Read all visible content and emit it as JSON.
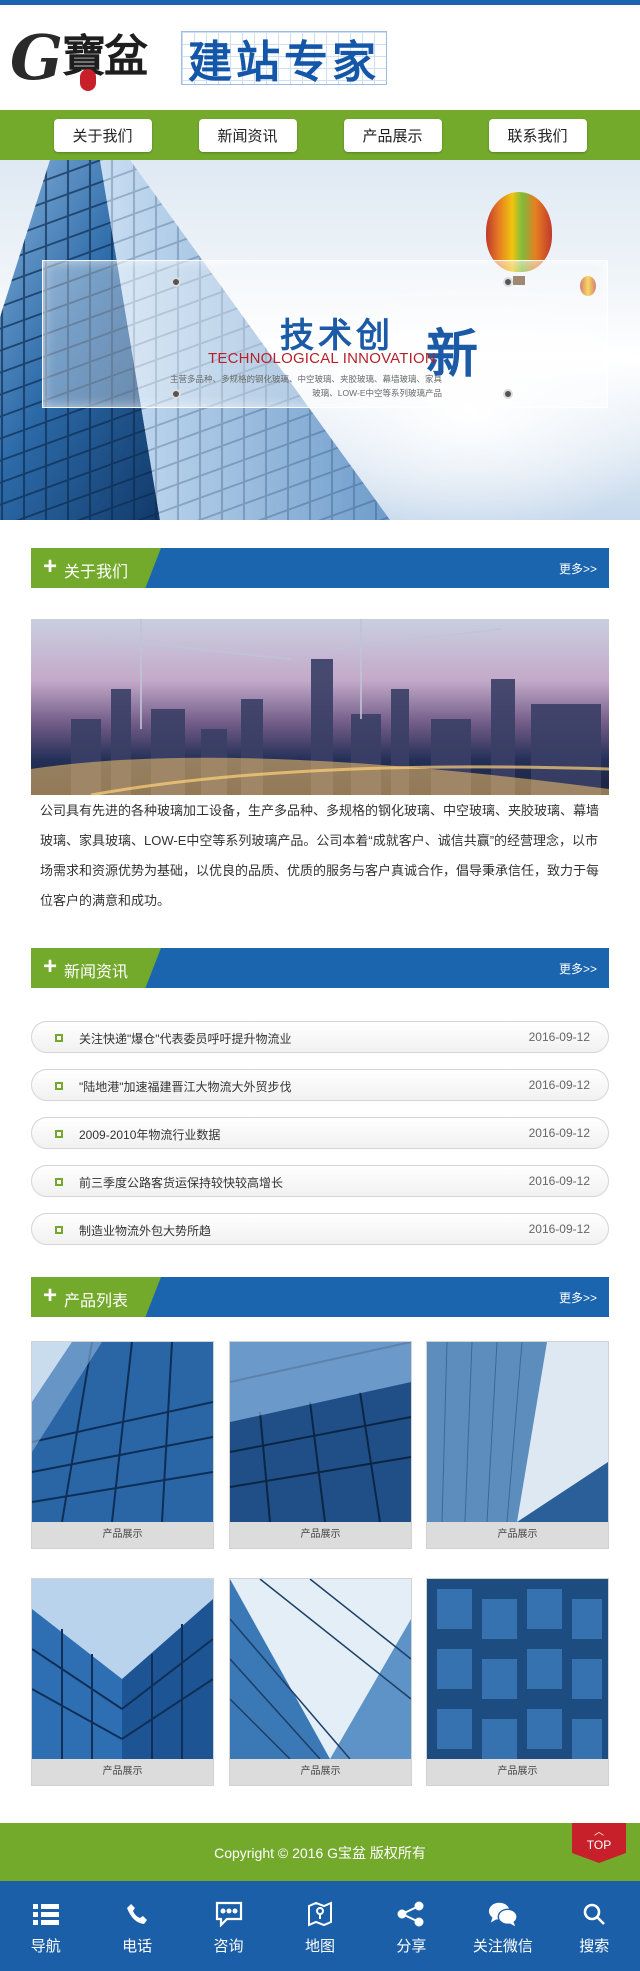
{
  "brand": {
    "logo_letter": "G",
    "logo_chinese": "寶盆",
    "title": "建站专家"
  },
  "nav": [
    {
      "label": "关于我们"
    },
    {
      "label": "新闻资讯"
    },
    {
      "label": "产品展示"
    },
    {
      "label": "联系我们"
    }
  ],
  "banner": {
    "slogan_cn_main": "技术创",
    "slogan_cn_big": "新",
    "slogan_en": "TECHNOLOGICAL INNOVATION",
    "slogan_sub": "主营多品种、多规格的钢化玻璃、中空玻璃、夹胶玻璃、幕墙玻璃、家具玻璃、LOW-E中空等系列玻璃产品"
  },
  "about": {
    "section_title": "关于我们",
    "more": "更多>>",
    "text": "公司具有先进的各种玻璃加工设备，生产多品种、多规格的钢化玻璃、中空玻璃、夹胶玻璃、幕墙玻璃、家具玻璃、LOW-E中空等系列玻璃产品。公司本着“成就客户、诚信共赢”的经营理念，以市场需求和资源优势为基础，以优良的品质、优质的服务与客户真诚合作，倡导秉承信任，致力于每位客户的满意和成功。"
  },
  "news": {
    "section_title": "新闻资讯",
    "more": "更多>>",
    "items": [
      {
        "title": "关注快递\"爆仓\"代表委员呼吁提升物流业",
        "date": "2016-09-12"
      },
      {
        "title": "\"陆地港\"加速福建晋江大物流大外贸步伐",
        "date": "2016-09-12"
      },
      {
        "title": "2009-2010年物流行业数据",
        "date": "2016-09-12"
      },
      {
        "title": "前三季度公路客货运保持较快较高增长",
        "date": "2016-09-12"
      },
      {
        "title": "制造业物流外包大势所趋",
        "date": "2016-09-12"
      }
    ]
  },
  "products": {
    "section_title": "产品列表",
    "more": "更多>>",
    "items": [
      {
        "caption": "产品展示"
      },
      {
        "caption": "产品展示"
      },
      {
        "caption": "产品展示"
      },
      {
        "caption": "产品展示"
      },
      {
        "caption": "产品展示"
      },
      {
        "caption": "产品展示"
      }
    ]
  },
  "footer": {
    "copyright": "Copyright © 2016 G宝盆 版权所有",
    "top_label": "TOP",
    "top_arrow": "︿"
  },
  "bottom_bar": [
    {
      "label": "导航",
      "icon": "menu-icon"
    },
    {
      "label": "电话",
      "icon": "phone-icon"
    },
    {
      "label": "咨询",
      "icon": "chat-icon"
    },
    {
      "label": "地图",
      "icon": "map-icon"
    },
    {
      "label": "分享",
      "icon": "share-icon"
    },
    {
      "label": "关注微信",
      "icon": "wechat-icon"
    },
    {
      "label": "搜索",
      "icon": "search-icon"
    }
  ],
  "colors": {
    "blue": "#1b64ae",
    "green": "#73aa2c",
    "red": "#c8202a",
    "dark_blue": "#1b5fa8"
  }
}
